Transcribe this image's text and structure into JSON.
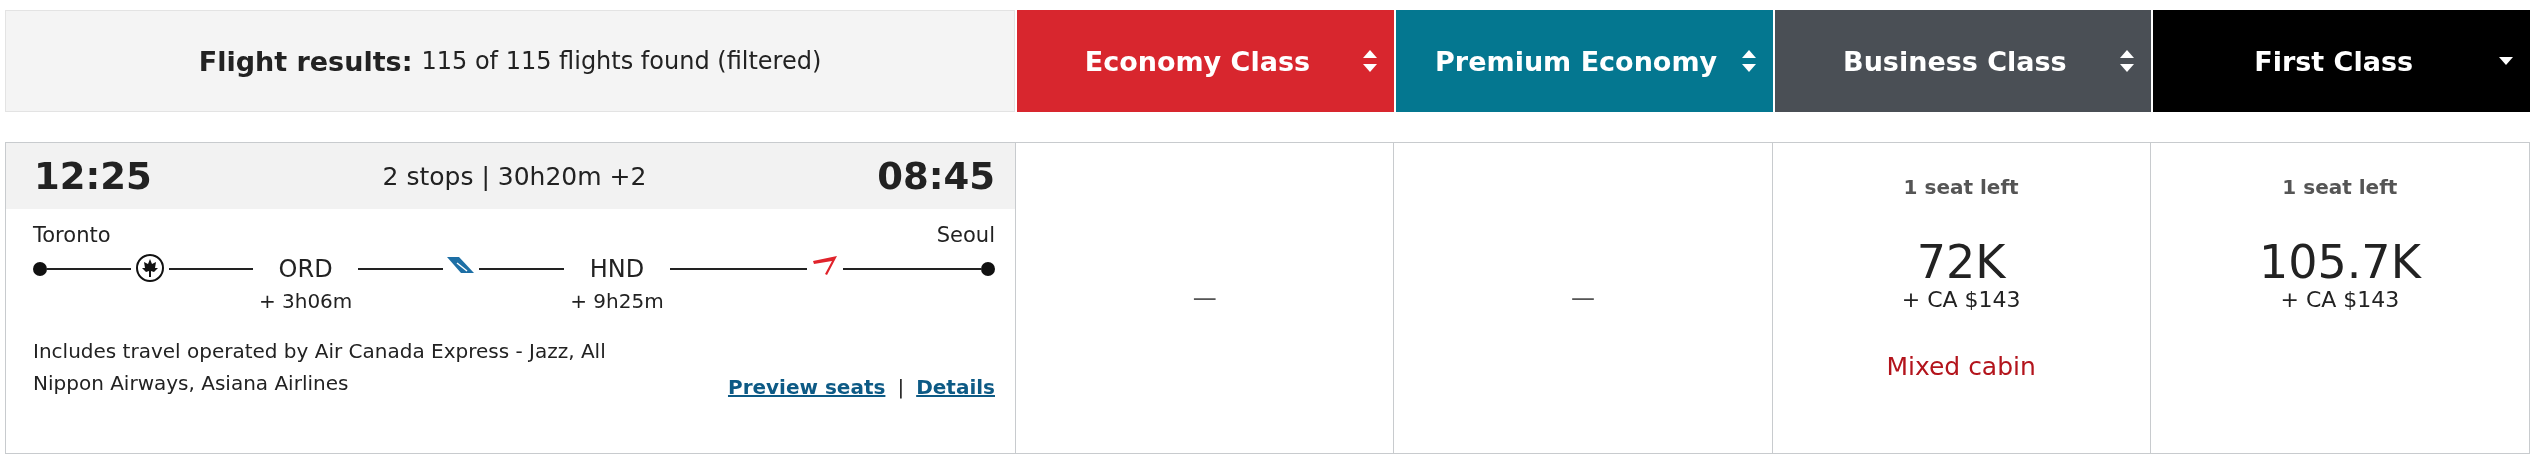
{
  "summary": {
    "label": "Flight results:",
    "text": "115 of 115 flights found (filtered)"
  },
  "cabins": [
    {
      "label": "Economy Class",
      "color": "#d8262e",
      "selected": false
    },
    {
      "label": "Premium Economy",
      "color": "#047790",
      "selected": false
    },
    {
      "label": "Business Class",
      "color": "#4a4f55",
      "selected": false
    },
    {
      "label": "First Class",
      "color": "#000000",
      "selected": true
    }
  ],
  "flight": {
    "depart": "12:25",
    "summary": "2 stops | 30h20m +2",
    "arrive": "08:45",
    "origin": "Toronto",
    "destination": "Seoul",
    "segments": [
      {
        "kind": "maple",
        "stop": "ORD",
        "layover": "+ 3h06m"
      },
      {
        "kind": "tail",
        "stop": "HND",
        "layover": "+ 9h25m"
      },
      {
        "kind": "swoosh"
      }
    ],
    "operated_by": "Includes travel operated by Air Canada Express - Jazz, All Nippon Airways, Asiana Airlines",
    "links": [
      "Preview seats",
      "Details"
    ],
    "separator": "|"
  },
  "fares": [
    {
      "kind": "empty",
      "text": "—"
    },
    {
      "kind": "empty",
      "text": "—"
    },
    {
      "kind": "offer",
      "seats": "1 seat left",
      "points": "72K",
      "cash": "+ CA $143",
      "note": "Mixed cabin"
    },
    {
      "kind": "offer",
      "seats": "1 seat left",
      "points": "105.7K",
      "cash": "+ CA $143"
    }
  ]
}
